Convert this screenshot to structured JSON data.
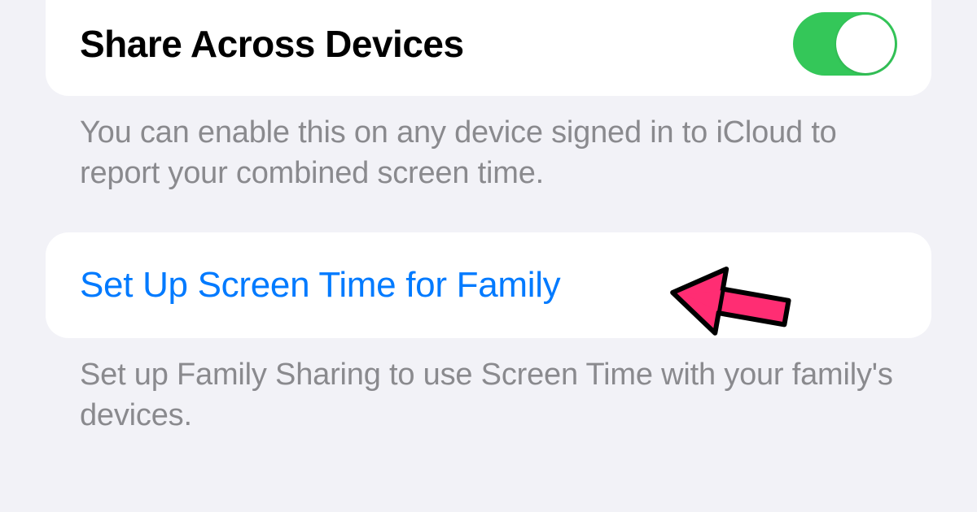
{
  "shareAcrossDevices": {
    "label": "Share Across Devices",
    "toggleOn": true,
    "footer": "You can enable this on any device signed in to iCloud to report your combined screen time."
  },
  "setUpFamily": {
    "label": "Set Up Screen Time for Family",
    "footer": "Set up Family Sharing to use Screen Time with your family's devices."
  },
  "colors": {
    "link": "#007aff",
    "toggleOn": "#34c759",
    "background": "#f2f2f7",
    "footerText": "#8a8a8e",
    "annotationFill": "#ff2d73"
  }
}
